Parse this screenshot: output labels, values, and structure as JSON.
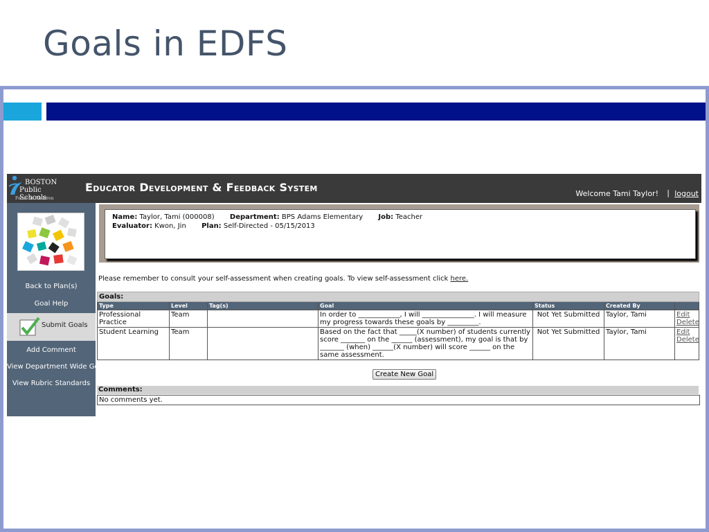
{
  "slide": {
    "title": "Goals in EDFS"
  },
  "logo": {
    "line1": "BOSTON",
    "line2": "Public Schools",
    "line3": "Focus on Children"
  },
  "header": {
    "title": "Educator Development & Feedback System",
    "welcome": "Welcome Tami Taylor!",
    "separator": "|",
    "logout": "logout"
  },
  "sidebar": {
    "items": [
      {
        "label": "Back to Plan(s)"
      },
      {
        "label": "Goal Help"
      },
      {
        "label": "Submit Goals"
      },
      {
        "label": "Add Comment"
      },
      {
        "label": "View Department Wide Goals"
      },
      {
        "label": "View Rubric Standards"
      }
    ]
  },
  "info": {
    "name_label": "Name:",
    "name": "Taylor, Tami (000008)",
    "dept_label": "Department:",
    "dept": "BPS Adams Elementary",
    "job_label": "Job:",
    "job": "Teacher",
    "evaluator_label": "Evaluator:",
    "evaluator": "Kwon, Jin",
    "plan_label": "Plan:",
    "plan": "Self-Directed - 05/15/2013"
  },
  "reminder": {
    "text": "Please remember to consult your self-assessment when creating goals. To view self-assessment click ",
    "link": "here."
  },
  "goals": {
    "title": "Goals:",
    "headers": {
      "type": "Type",
      "level": "Level",
      "tags": "Tag(s)",
      "goal": "Goal",
      "status": "Status",
      "created_by": "Created By"
    },
    "rows": [
      {
        "type": "Professional Practice",
        "level": "Team",
        "tags": "",
        "goal": "In order to ____________, I will _______________. I will measure my progress towards these goals by _________.",
        "status": "Not Yet Submitted",
        "created_by": "Taylor, Tami",
        "edit": "Edit",
        "delete": "Delete"
      },
      {
        "type": "Student Learning",
        "level": "Team",
        "tags": "",
        "goal": "Based on the fact that _____(X number) of students currently score _______ on the ______ (assessment), my goal is that by _______ (when) ______(X number) will score ______ on the same assessment.",
        "status": "Not Yet Submitted",
        "created_by": "Taylor, Tami",
        "edit": "Edit",
        "delete": "Delete"
      }
    ],
    "create_button": "Create New Goal"
  },
  "comments": {
    "title": "Comments:",
    "body": "No comments yet."
  },
  "colors": {
    "slide_title": "#44546a",
    "frame": "#8e9bcf",
    "accent_light": "#1aa6dd",
    "accent_dark": "#00118a",
    "sidebar": "#536578",
    "header": "#3a3a3a"
  }
}
